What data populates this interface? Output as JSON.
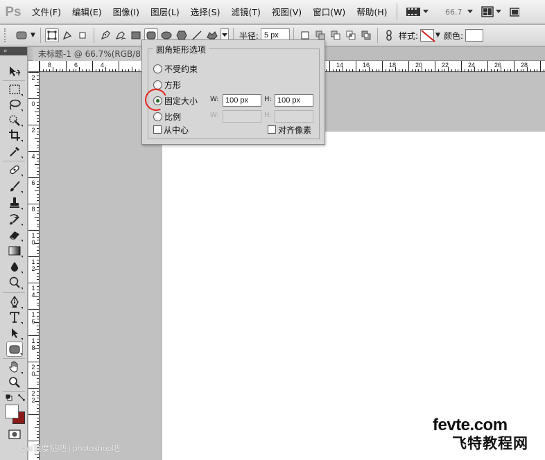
{
  "app": {
    "logo": "Ps",
    "menu": [
      "文件(F)",
      "编辑(E)",
      "图像(I)",
      "图层(L)",
      "选择(S)",
      "滤镜(T)",
      "视图(V)",
      "窗口(W)",
      "帮助(H)"
    ],
    "zoom_display": "66.7"
  },
  "options_bar": {
    "radius_label": "半径:",
    "radius_value": "5 px",
    "style_label": "样式:",
    "color_label": "颜色:",
    "style_swatch_color": "#d21a1a",
    "color_swatch_color": "#ffffff"
  },
  "tools": {
    "active": "rounded-rectangle-tool",
    "foreground_color": "#ffffff",
    "background_color": "#8b1a1a"
  },
  "document": {
    "tab_title": "未标题-1 @ 66.7%(RGB/8)",
    "ruler_h_labels": [
      "8",
      "6",
      "4",
      "14",
      "16",
      "18",
      "20",
      "22",
      "24",
      "26",
      "28"
    ],
    "ruler_v_labels": [
      "2",
      "0",
      "2",
      "4",
      "6",
      "8",
      "10",
      "12",
      "14",
      "16",
      "18",
      "20",
      "22"
    ]
  },
  "dialog": {
    "title": "圆角矩形选项",
    "options": [
      {
        "label": "不受约束",
        "selected": false
      },
      {
        "label": "方形",
        "selected": false
      },
      {
        "label": "固定大小",
        "selected": true
      },
      {
        "label": "比例",
        "selected": false
      }
    ],
    "fixed_w_label": "W:",
    "fixed_w_value": "100 px",
    "fixed_h_label": "H:",
    "fixed_h_value": "100 px",
    "ratio_w_label": "W:",
    "ratio_h_label": "H:",
    "from_center_label": "从中心",
    "snap_pixels_label": "对齐像素",
    "annotation_color": "#e3231b"
  },
  "watermarks": {
    "baidu": "Bai百度贴吧 | photoshop吧",
    "site_en": "fevte.com",
    "site_cn": "飞特教程网"
  }
}
